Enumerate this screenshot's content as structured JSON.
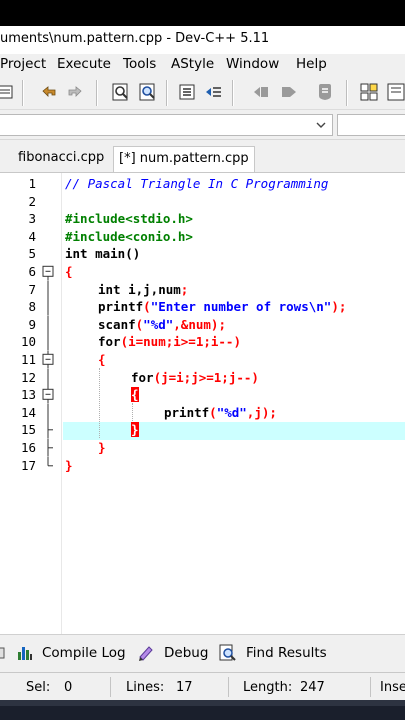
{
  "window": {
    "title": "uments\\num.pattern.cpp - Dev-C++ 5.11"
  },
  "menu": [
    "Project",
    "Execute",
    "Tools",
    "AStyle",
    "Window",
    "Help"
  ],
  "toolbar": {
    "icons": [
      "save-all-icon",
      "undo-icon",
      "redo-icon",
      "find-icon",
      "replace-icon",
      "indent-icon",
      "unindent-icon",
      "toggle-breakpoint-icon",
      "bookmark-icon",
      "goto-icon",
      "check-icon",
      "new-class-icon"
    ]
  },
  "tabs": [
    {
      "label": "fibonacci.cpp",
      "active": false
    },
    {
      "label": "[*] num.pattern.cpp",
      "active": true
    }
  ],
  "editor": {
    "line_numbers": [
      "1",
      "2",
      "3",
      "4",
      "5",
      "6",
      "7",
      "8",
      "9",
      "10",
      "11",
      "12",
      "13",
      "14",
      "15",
      "16",
      "17"
    ],
    "active_line": 15,
    "lines": {
      "l1": "// Pascal Triangle In C Programming",
      "l3": "#include<stdio.h>",
      "l4": "#include<conio.h>",
      "l5": "int main()",
      "l6": "{",
      "l7_kw": "int",
      "l7_rest": " i,j,num",
      "l7_semi": ";",
      "l8_fn": "printf",
      "l8_open": "(",
      "l8_str": "\"Enter number of rows\\n\"",
      "l8_close": ");",
      "l9_fn": "scanf",
      "l9_open": "(",
      "l9_str": "\"%d\"",
      "l9_mid": ",&num",
      "l9_close": ");",
      "l10_kw": "for",
      "l10_rest": "(i=num;i>=1;i--)",
      "l11": "{",
      "l12_kw": "for",
      "l12_rest": "(j=i;j>=1;j--)",
      "l13": "{",
      "l14_fn": "printf",
      "l14_open": "(",
      "l14_str": "\"%d\"",
      "l14_mid": ",j",
      "l14_close": ");",
      "l15": "}",
      "l16": "}",
      "l17": "}"
    }
  },
  "bottom_tabs": [
    {
      "label": "Compile Log",
      "icon": "compile-log-icon"
    },
    {
      "label": "Debug",
      "icon": "debug-icon"
    },
    {
      "label": "Find Results",
      "icon": "find-results-icon"
    }
  ],
  "status": {
    "sel_label": "Sel:",
    "sel_value": "0",
    "lines_label": "Lines:",
    "lines_value": "17",
    "length_label": "Length:",
    "length_value": "247",
    "mode": "Inse"
  }
}
